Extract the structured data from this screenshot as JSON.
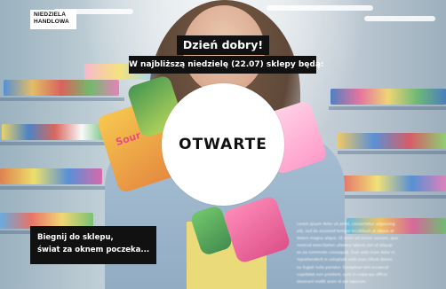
{
  "logo": {
    "line1": "NIEDZIELA",
    "line2": "HANDLOWA"
  },
  "greeting": "Dzień dobry!",
  "subline": "W najbliższą niedzielę (22.07) sklepy będą:",
  "status": "OTWARTE",
  "caption": {
    "line1": "Biegnij do sklepu,",
    "line2": "świat za oknem poczeka..."
  },
  "fineprint": [
    "Lorem ipsum dolor sit amet, consectetur adipiscing",
    "elit, sed do eiusmod tempor incididunt ut labore et",
    "dolore magna aliqua. Ut enim ad minim veniam, quis",
    "nostrud exercitation ullamco laboris nisi ut aliquip",
    "ex ea commodo consequat. Duis aute irure dolor in",
    "reprehenderit in voluptate velit esse cillum dolore",
    "eu fugiat nulla pariatur. Excepteur sint occaecat",
    "cupidatat non proident, sunt in culpa qui officia",
    "deserunt mollit anim id est laborum."
  ],
  "colors": {
    "label_bg": "#111111",
    "label_text": "#ffffff",
    "circle_bg": "#ffffff"
  },
  "background": {
    "description_icon": "grocery-store-photo"
  }
}
